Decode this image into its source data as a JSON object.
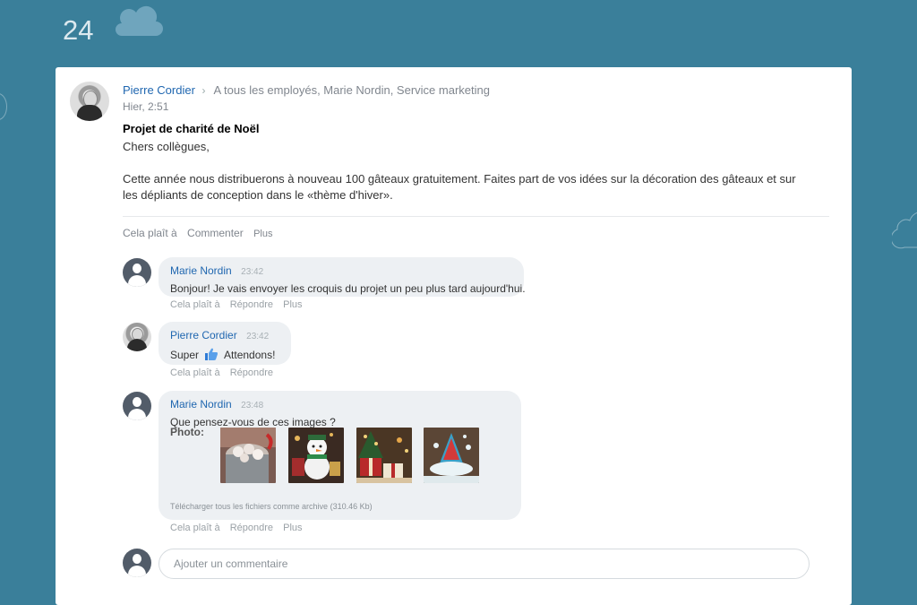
{
  "header": {
    "day_number": "24",
    "cloud_icon": "cloud-icon"
  },
  "post": {
    "author": "Pierre Cordier",
    "recipients": "A tous les employés, Marie Nordin, Service marketing",
    "time": "Hier, 2:51",
    "title": "Projet de charité de Noël",
    "greeting": "Chers collègues,",
    "body": "Cette année nous distribuerons à nouveau 100 gâteaux gratuitement. Faites part de vos idées sur la décoration des gâteaux et sur les dépliants de conception dans le «thème d'hiver».",
    "actions": {
      "like": "Cela plaît à",
      "comment": "Commenter",
      "more": "Plus"
    }
  },
  "comments": [
    {
      "author": "Marie Nordin",
      "time": "23:42",
      "text": "Bonjour! Je vais envoyer les croquis du projet un peu plus tard aujourd'hui.",
      "actions": {
        "like": "Cela plaît à",
        "reply": "Répondre",
        "more": "Plus"
      }
    },
    {
      "author": "Pierre Cordier",
      "time": "23:42",
      "text_before": "Super",
      "emoji": "thumbs-up-icon",
      "text_after": "Attendons!",
      "actions": {
        "like": "Cela plaît à",
        "reply": "Répondre"
      }
    },
    {
      "author": "Marie Nordin",
      "time": "23:48",
      "text": "Que pensez-vous de ces images ?",
      "photo_label": "Photo:",
      "download": "Télécharger tous les fichiers comme archive (310.46 Kb)",
      "actions": {
        "like": "Cela plaît à",
        "reply": "Répondre",
        "more": "Plus"
      }
    }
  ],
  "add_comment": {
    "placeholder": "Ajouter un commentaire"
  },
  "colors": {
    "background": "#3a7f9a",
    "author_link": "#2067b0",
    "bubble": "#edf0f3"
  }
}
